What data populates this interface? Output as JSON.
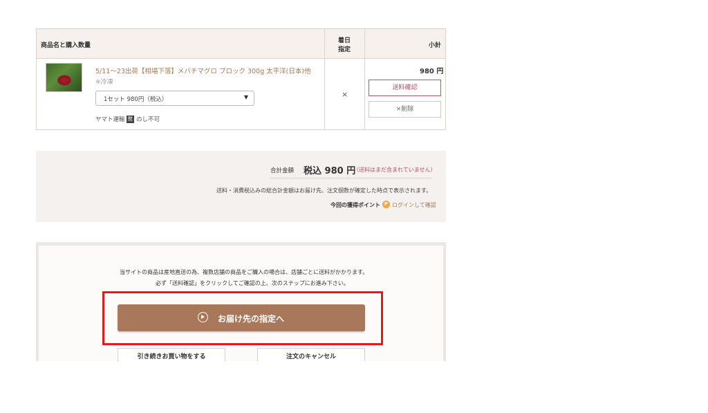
{
  "cart": {
    "headers": {
      "product": "商品名と購入数量",
      "date_line1": "着日",
      "date_line2": "指定",
      "subtotal": "小計"
    },
    "item": {
      "name": "5/11～23出荷【相場下落】メバチマグロ ブロック 300g 太平洋(日本)他",
      "storage": "※冷凍",
      "option": "1セット 980円（税込）",
      "shipping_carrier": "ヤマト運輸",
      "noshi_icon_char": "熨",
      "noshi": "のし不可",
      "date_mark": "×",
      "price": "980 円",
      "ship_button": "送料確認",
      "delete_button": "×削除"
    }
  },
  "totals": {
    "label": "合計金額",
    "amount": "税込 980 円",
    "note": "（送料はまだ含まれていません）",
    "description": "送料・消費税込みの総合計金額はお届け先、注文個数が確定した時点で表示されます。",
    "points_label": "今回の獲得ポイント",
    "points_icon": "P",
    "points_link": "ログインして確認"
  },
  "checkout": {
    "info_line1": "当サイトの商品は産地直送の為、複数店舗の商品をご購入の場合は、店舗ごとに送料がかかります。",
    "info_line2": "必ず「送料確認」をクリックしてご確認の上、次のステップにお進み下さい。",
    "next_button": "お届け先の指定へ",
    "continue_button": "引き続きお買い物をする",
    "cancel_button": "注文のキャンセル"
  },
  "colors": {
    "accent_brown": "#a9775a",
    "highlight_red": "#e11b1b",
    "ship_button": "#b05367"
  }
}
